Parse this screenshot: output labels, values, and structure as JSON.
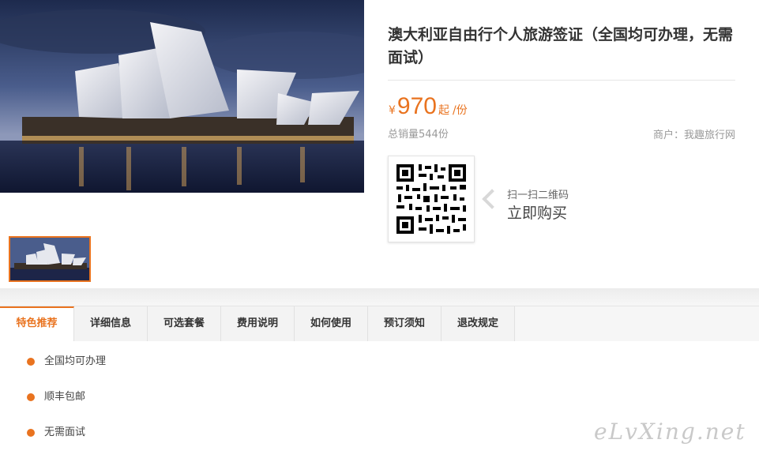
{
  "product": {
    "title": "澳大利亚自由行个人旅游签证（全国均可办理，无需面试）",
    "currency_symbol": "¥",
    "price": "970",
    "price_suffix": "起",
    "price_unit": "/份",
    "sales": "总销量544份",
    "merchant": "商户：我趣旅行网"
  },
  "qr": {
    "hint": "扫一扫二维码",
    "action": "立即购买"
  },
  "tabs": [
    {
      "label": "特色推荐"
    },
    {
      "label": "详细信息"
    },
    {
      "label": "可选套餐"
    },
    {
      "label": "费用说明"
    },
    {
      "label": "如何使用"
    },
    {
      "label": "预订须知"
    },
    {
      "label": "退改规定"
    }
  ],
  "active_tab": "特色推荐",
  "features": [
    {
      "text": "全国均可办理"
    },
    {
      "text": "顺丰包邮"
    },
    {
      "text": "无需面试"
    }
  ],
  "watermark": "eLvXing.net",
  "colors": {
    "accent": "#e9731f",
    "muted_text": "#999999",
    "tab_bg": "#f3f3f3"
  }
}
